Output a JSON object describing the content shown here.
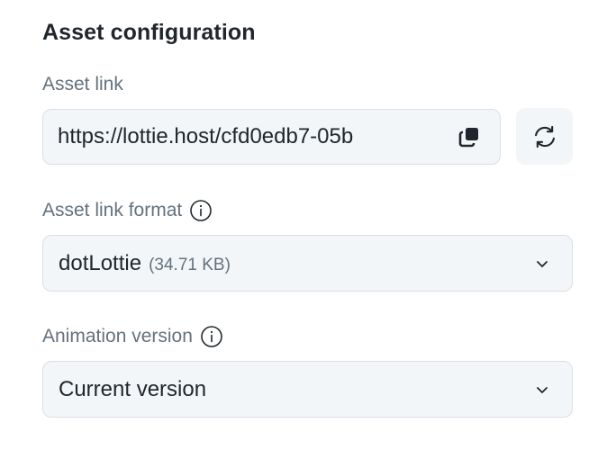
{
  "panel": {
    "title": "Asset configuration"
  },
  "asset_link": {
    "label": "Asset link",
    "value": "https://lottie.host/cfd0edb7-05b",
    "copy_icon": "copy-icon",
    "refresh_icon": "refresh-icon"
  },
  "asset_link_format": {
    "label": "Asset link format",
    "info_icon": "info-icon",
    "selected": "dotLottie",
    "size": "(34.71 KB)",
    "chevron_icon": "chevron-down-icon"
  },
  "animation_version": {
    "label": "Animation version",
    "info_icon": "info-icon",
    "selected": "Current version",
    "chevron_icon": "chevron-down-icon"
  },
  "colors": {
    "text_primary": "#20272c",
    "text_secondary": "#63727e",
    "field_bg": "#f3f6f8",
    "field_border": "#d9e0e6"
  }
}
